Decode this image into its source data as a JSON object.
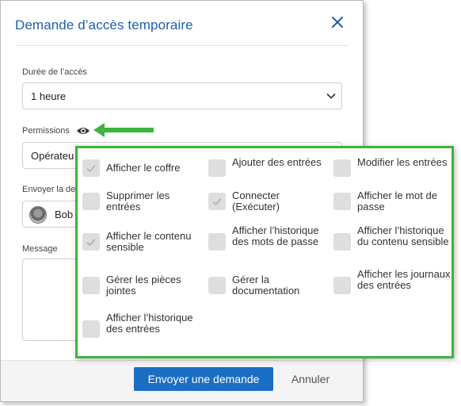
{
  "dialog": {
    "title": "Demande d’accès temporaire",
    "duration_label": "Durée de l’accès",
    "duration_value": "1 heure",
    "permissions_label": "Permissions",
    "permissions_value": "Opérateu",
    "send_to_label": "Envoyer la de",
    "send_to_value": "Bob",
    "message_label": "Message",
    "submit_label": "Envoyer une demande",
    "cancel_label": "Annuler"
  },
  "colors": {
    "accent": "#1a6ec3",
    "title": "#1f5fa8",
    "highlight": "#3bb53b",
    "checkbox": "#dedede"
  },
  "icons": [
    "close-icon",
    "chevron-down-icon",
    "eye-icon",
    "green-arrow-icon",
    "user-avatar",
    "check-icon"
  ],
  "permissions": [
    {
      "label": "Afficher le coffre",
      "checked": true
    },
    {
      "label": "Ajouter des entrées",
      "checked": false
    },
    {
      "label": "Modifier les entrées",
      "checked": false
    },
    {
      "label": "Supprimer les entrées",
      "checked": false
    },
    {
      "label": "Connecter (Exécuter)",
      "checked": true
    },
    {
      "label": "Afficher le mot de passe",
      "checked": false
    },
    {
      "label": "Afficher le contenu sensible",
      "checked": true
    },
    {
      "label": "Afficher l’historique des mots de passe",
      "checked": false
    },
    {
      "label": "Afficher l’historique du contenu sensible",
      "checked": false
    },
    {
      "label": "Gérer les pièces jointes",
      "checked": false
    },
    {
      "label": "Gérer la documentation",
      "checked": false
    },
    {
      "label": "Afficher les journaux des entrées",
      "checked": false
    },
    {
      "label": "Afficher l’historique des entrées",
      "checked": false
    }
  ]
}
